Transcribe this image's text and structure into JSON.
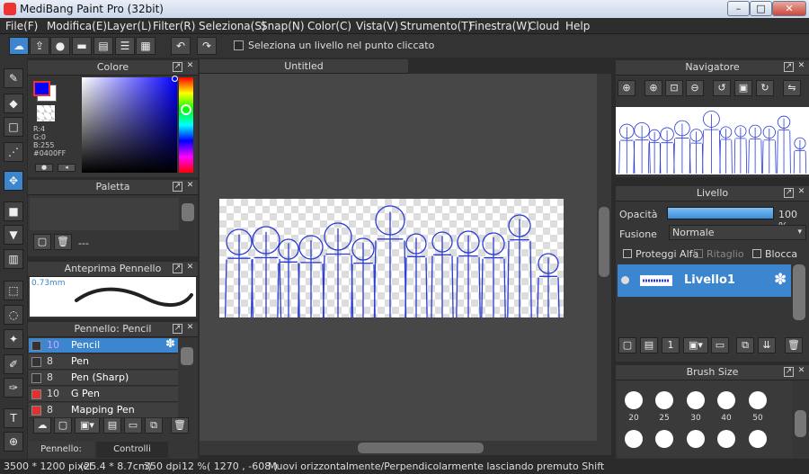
{
  "app": {
    "title": "MediBang Paint Pro (32bit)"
  },
  "window_controls": {
    "minimize": "–",
    "maximize": "□",
    "close": "✕"
  },
  "menu": [
    "File(F)",
    "Modifica(E)",
    "Layer(L)",
    "Filter(R)",
    "Seleziona(S)",
    "Snap(N)",
    "Color(C)",
    "Vista(V)",
    "Strumento(T)",
    "Finestra(W)",
    "Cloud",
    "Help"
  ],
  "toolbar": {
    "checkbox_label": "Seleziona un livello nel punto cliccato"
  },
  "color_panel": {
    "title": "Colore",
    "r": "R:4",
    "g": "G:0",
    "b": "B:255",
    "hex": "#0400FF",
    "primary": "#0400ff",
    "secondary": "#ffffff"
  },
  "palette_panel": {
    "title": "Paletta",
    "text": "---"
  },
  "preview_panel": {
    "title": "Anteprima Pennello",
    "size": "0.73mm"
  },
  "brush_panel": {
    "title": "Pennello: Pencil",
    "items": [
      {
        "size": "10",
        "name": "Pencil",
        "color": "#333333",
        "selected": true
      },
      {
        "size": "8",
        "name": "Pen",
        "color": "#333333",
        "selected": false
      },
      {
        "size": "8",
        "name": "Pen (Sharp)",
        "color": "#333333",
        "selected": false
      },
      {
        "size": "10",
        "name": "G Pen",
        "color": "#e03030",
        "selected": false
      },
      {
        "size": "8",
        "name": "Mapping Pen",
        "color": "#e03030",
        "selected": false
      }
    ],
    "tab1": "Pennello: Pencil",
    "tab2": "Controlli Pennello"
  },
  "document": {
    "tab": "Untitled"
  },
  "navigator": {
    "title": "Navigatore"
  },
  "layer_panel": {
    "title": "Livello",
    "opacity_label": "Opacità",
    "opacity_value": "100 %",
    "opacity_fraction": 1.0,
    "blend_label": "Fusione",
    "blend_value": "Normale",
    "protect_alpha": "Proteggi Alfa",
    "clipping": "Ritaglio",
    "lock": "Blocca",
    "layer_name": "Livello1"
  },
  "brush_size": {
    "title": "Brush Size",
    "row1": [
      "20",
      "25",
      "30",
      "40",
      "50"
    ]
  },
  "status": {
    "size": "3500 * 1200 pixel",
    "cm": "(25.4 * 8.7cm)",
    "dpi": "350 dpi",
    "zoom": "12 %",
    "coords": "( 1270 , -608 )",
    "hint": "Muovi orizzontalmente/Perpendicolarmente lasciando premuto Shift"
  }
}
